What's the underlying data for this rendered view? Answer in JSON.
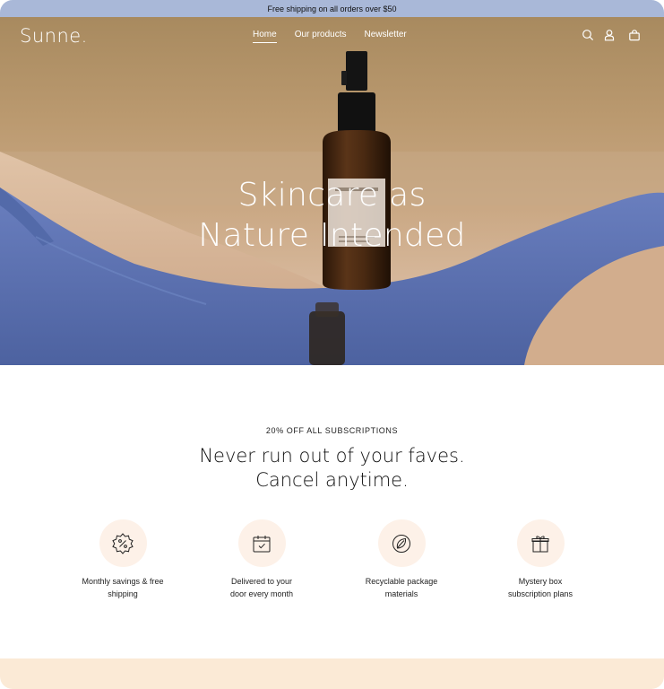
{
  "announcement": "Free shipping on all orders over $50",
  "header": {
    "logo": "Sunne.",
    "nav": [
      {
        "label": "Home",
        "active": true
      },
      {
        "label": "Our products",
        "active": false
      },
      {
        "label": "Newsletter",
        "active": false
      }
    ],
    "icons": [
      "search-icon",
      "account-icon",
      "cart-icon"
    ]
  },
  "hero": {
    "title_line1": "Skincare as",
    "title_line2": "Nature Intended"
  },
  "promo": {
    "eyebrow": "20% OFF ALL SUBSCRIPTIONS",
    "headline_line1": "Never run out of your faves.",
    "headline_line2": "Cancel anytime."
  },
  "features": [
    {
      "icon": "discount-badge-icon",
      "line1": "Monthly savings & free",
      "line2": "shipping"
    },
    {
      "icon": "calendar-check-icon",
      "line1": "Delivered to your",
      "line2": "door every month"
    },
    {
      "icon": "leaf-icon",
      "line1": "Recyclable package",
      "line2": "materials"
    },
    {
      "icon": "gift-icon",
      "line1": "Mystery box",
      "line2": "subscription plans"
    }
  ],
  "colors": {
    "announcement_bg": "#a9b8d8",
    "feature_circle_bg": "#fdf1e8",
    "footer_band": "#fbead6",
    "swimsuit_blue": "#5a6fad"
  }
}
